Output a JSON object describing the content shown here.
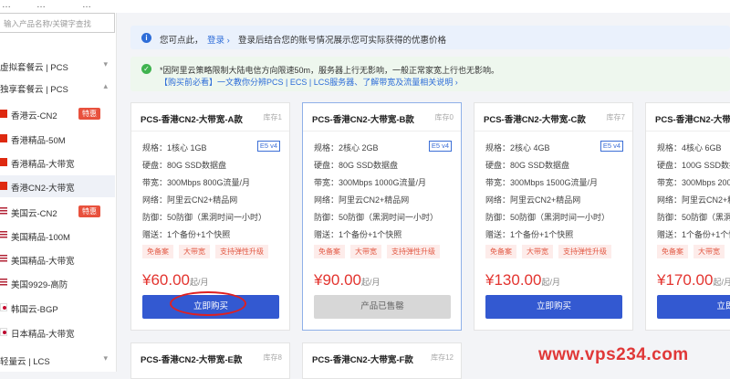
{
  "topstrip": {
    "items": [
      "…",
      "…",
      "…"
    ]
  },
  "search": {
    "placeholder": "输入产品名称/关键字查找"
  },
  "sidebar": {
    "categories": [
      {
        "label": "虚拟套餐云 | PCS",
        "chevron": "▾"
      },
      {
        "label": "独享套餐云 | PCS",
        "chevron": "▴"
      },
      {
        "label": "轻量云 | LCS",
        "chevron": "▾"
      }
    ],
    "items": [
      {
        "flag": "hk",
        "label": "香港云-CN2",
        "badge": "特惠"
      },
      {
        "flag": "hk",
        "label": "香港精品-50M"
      },
      {
        "flag": "hk",
        "label": "香港精品-大带宽"
      },
      {
        "flag": "hk",
        "label": "香港CN2-大带宽"
      },
      {
        "flag": "us",
        "label": "美国云-CN2",
        "badge": "特惠"
      },
      {
        "flag": "us",
        "label": "美国精品-100M"
      },
      {
        "flag": "us",
        "label": "美国精品-大带宽"
      },
      {
        "flag": "us",
        "label": "美国9929-高防"
      },
      {
        "flag": "kr",
        "label": "韩国云-BGP"
      },
      {
        "flag": "jp",
        "label": "日本精品-大带宽"
      }
    ]
  },
  "notices": {
    "info": {
      "prefix": "您可点此，",
      "link": "登录 ›",
      "text": "登录后结合您的账号情况展示您可实际获得的优惠价格"
    },
    "warn": {
      "line1": "*因阿里云策略限制大陆电信方向限速50m，服务器上行无影响，一般正常家宽上行也无影响。",
      "line2": "【购买前必看】一文教你分辨PCS | ECS | LCS服务器、了解带宽及流量相关说明 ›"
    }
  },
  "cards": [
    {
      "title": "PCS-香港CN2-大带宽-A款",
      "stock": "库存1",
      "spec": "规格：1核心 1GB",
      "cpu_tag": "E5 v4",
      "disk": "硬盘：80G SSD数据盘",
      "bw": "带宽：300Mbps 800G流量/月",
      "net": "网络：阿里云CN2+精品网",
      "ddos": "防御：50防御（黑洞时间一小时）",
      "gift": "赠送：1个备份+1个快照",
      "tags": [
        "免备案",
        "大带宽",
        "支持弹性升级"
      ],
      "price": "¥60.00",
      "unit": "起/月",
      "button": "立即购买"
    },
    {
      "title": "PCS-香港CN2-大带宽-B款",
      "stock": "库存0",
      "spec": "规格：2核心 2GB",
      "cpu_tag": "E5 v4",
      "disk": "硬盘：80G SSD数据盘",
      "bw": "带宽：300Mbps 1000G流量/月",
      "net": "网络：阿里云CN2+精品网",
      "ddos": "防御：50防御（黑洞时间一小时）",
      "gift": "赠送：1个备份+1个快照",
      "tags": [
        "免备案",
        "大带宽",
        "支持弹性升级"
      ],
      "price": "¥90.00",
      "unit": "起/月",
      "button": "产品已售罄"
    },
    {
      "title": "PCS-香港CN2-大带宽-C款",
      "stock": "库存7",
      "spec": "规格：2核心 4GB",
      "cpu_tag": "E5 v4",
      "disk": "硬盘：80G SSD数据盘",
      "bw": "带宽：300Mbps 1500G流量/月",
      "net": "网络：阿里云CN2+精品网",
      "ddos": "防御：50防御（黑洞时间一小时）",
      "gift": "赠送：1个备份+1个快照",
      "tags": [
        "免备案",
        "大带宽",
        "支持弹性升级"
      ],
      "price": "¥130.00",
      "unit": "起/月",
      "button": "立即购买"
    },
    {
      "title": "PCS-香港CN2-大带宽-D款",
      "stock": "库存",
      "spec": "规格：4核心 6GB",
      "cpu_tag": "",
      "disk": "硬盘：100G SSD数据盘",
      "bw": "带宽：300Mbps 2000G",
      "net": "网络：阿里云CN2+精",
      "ddos": "防御：50防御（黑洞",
      "gift": "赠送：1个备份+1个快",
      "tags": [
        "免备案",
        "大带宽",
        "支持弹"
      ],
      "price": "¥170.00",
      "unit": "起/月",
      "button": "立即"
    }
  ],
  "cards_row2": [
    {
      "title": "PCS-香港CN2-大带宽-E款",
      "stock": "库存8"
    },
    {
      "title": "PCS-香港CN2-大带宽-F款",
      "stock": "库存12"
    }
  ],
  "watermark": "www.vps234.com",
  "colors": {
    "accent": "#3359d1",
    "price": "#e3342f",
    "badge": "#e8513d",
    "sold": "#d7d7d7"
  }
}
